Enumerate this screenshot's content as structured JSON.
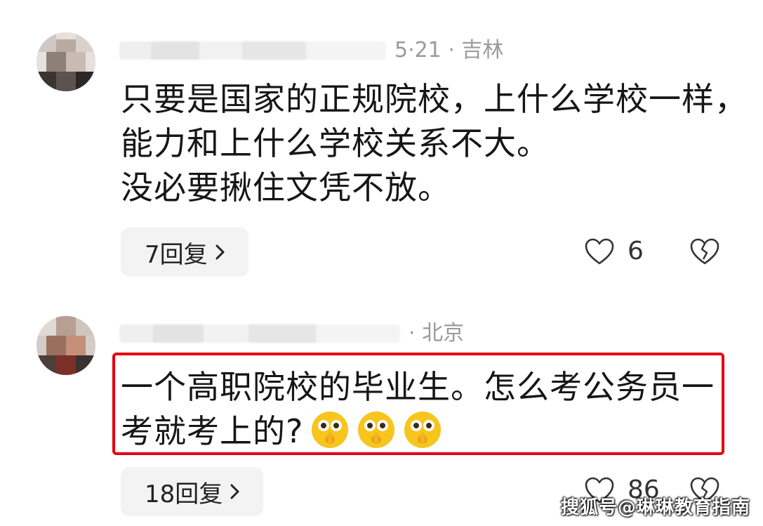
{
  "comments": [
    {
      "meta_suffix": "5·21 · 吉林",
      "lines": [
        "只要是国家的正规院校，上什么学校一样，",
        "能力和上什么学校关系不大。",
        "没必要揪住文凭不放。"
      ],
      "reply_label": "7回复",
      "like_count": "6"
    },
    {
      "meta_suffix": "· 北京",
      "lines": [
        "一个高职院校的毕业生。怎么考公务员一",
        "考就考上的?"
      ],
      "emoji_count": 3,
      "reply_label": "18回复",
      "like_count": "86"
    }
  ],
  "watermark": "搜狐号@琳琳教育指南",
  "colors": {
    "highlight_border": "#e60012",
    "reply_bg": "#f3f3f3",
    "text": "#161616",
    "meta": "#9a9a9a"
  },
  "icons": {
    "like": "heart-icon",
    "dislike": "broken-heart-icon",
    "reply_arrow": "chevron-right-icon",
    "emoji": "shushing-face-emoji-icon"
  }
}
